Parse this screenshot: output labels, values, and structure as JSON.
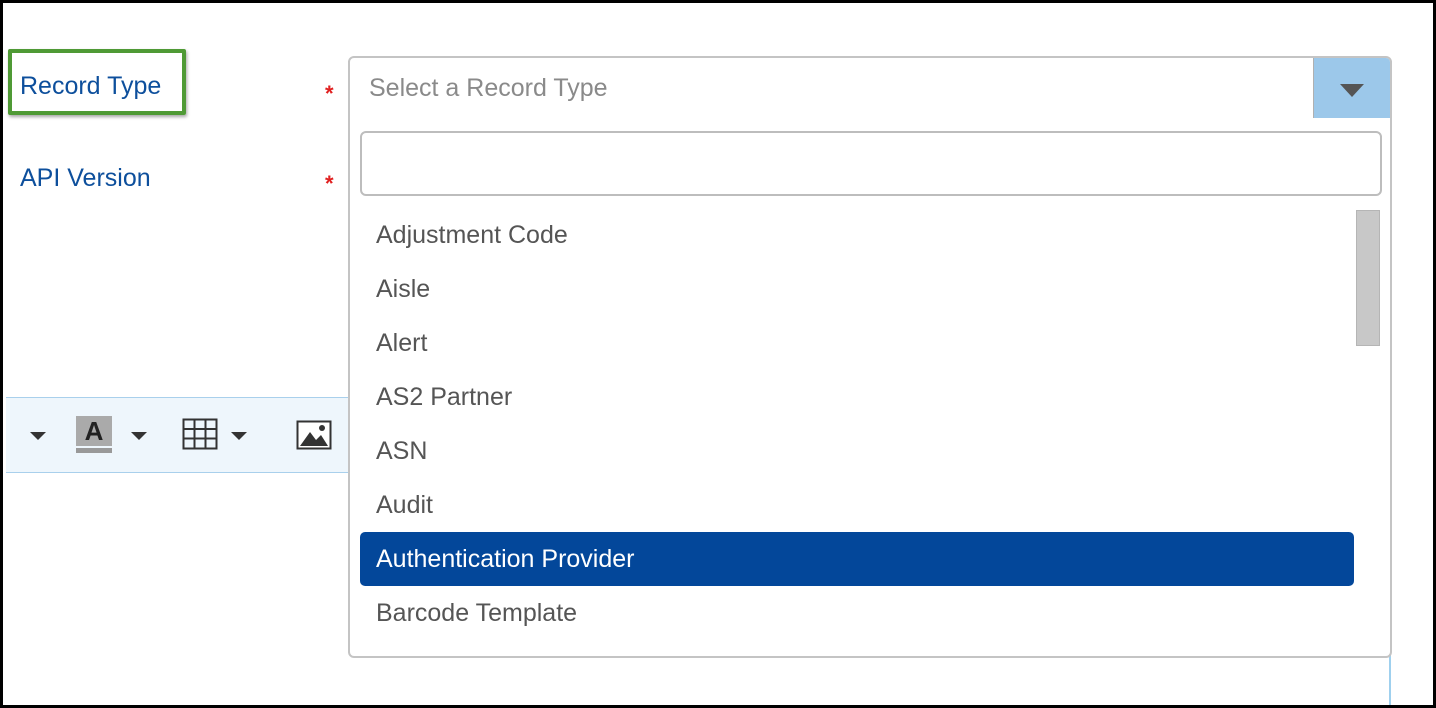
{
  "form": {
    "record_type_label": "Record Type",
    "api_version_label": "API Version",
    "required_marker": "*"
  },
  "select": {
    "placeholder": "Select a Record Type",
    "search_value": ""
  },
  "dropdown": {
    "options": [
      "Adjustment Code",
      "Aisle",
      "Alert",
      "AS2 Partner",
      "ASN",
      "Audit",
      "Authentication Provider",
      "Barcode Template"
    ],
    "selected": "Authentication Provider"
  },
  "toolbar": {
    "font_color_glyph": "A"
  },
  "colors": {
    "label_blue": "#0d4f9c",
    "highlight_green": "#4f9a35",
    "selected_bg": "#03479a",
    "select_button_bg": "#9cc8ea",
    "required_red": "#e02020"
  },
  "icons": [
    "dropdown-caret-icon",
    "font-color-icon",
    "table-icon",
    "image-icon",
    "select-arrow-icon"
  ]
}
